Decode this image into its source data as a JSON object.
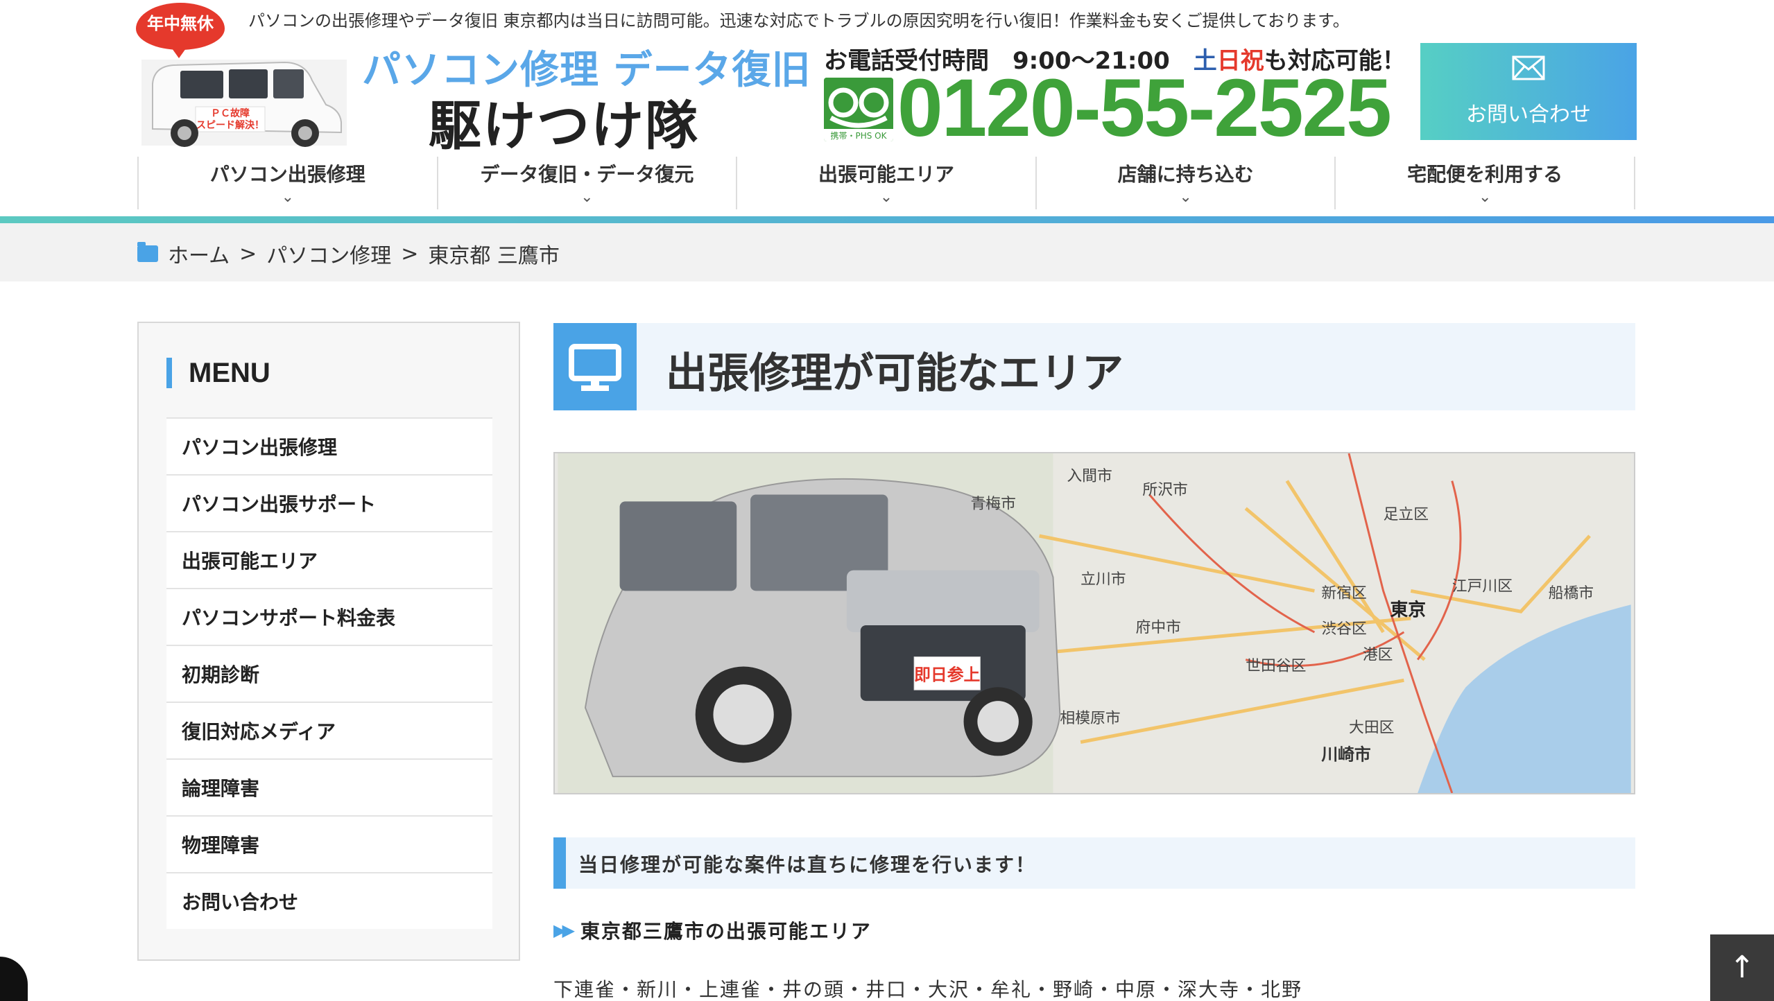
{
  "header": {
    "tagline": "パソコンの出張修理やデータ復旧 東京都内は当日に訪問可能。迅速な対応でトラブルの原因究明を行い復旧！作業料金も安くご提供しております。",
    "badge": "年中無休",
    "van_sticker": "ＰＣ故障 スピード解決！",
    "title_line1": "パソコン修理 データ復旧",
    "title_line2": "駆けつけ隊",
    "hours_prefix": "お電話受付時間　9:00〜21:00　",
    "hours_sat": "土",
    "hours_hol": "日祝",
    "hours_suffix": "も対応可能！",
    "freedial_note": "携帯・PHS OK",
    "phone": "0120-55-2525",
    "contact_label": "お問い合わせ"
  },
  "nav": {
    "items": [
      {
        "label": "パソコン出張修理"
      },
      {
        "label": "データ復旧・データ復元"
      },
      {
        "label": "出張可能エリア"
      },
      {
        "label": "店舗に持ち込む"
      },
      {
        "label": "宅配便を利用する"
      }
    ],
    "chevron": "⌄"
  },
  "breadcrumb": {
    "home": "ホーム",
    "sep": ">",
    "level1": "パソコン修理",
    "current": "東京都 三鷹市"
  },
  "sidebar": {
    "title": "MENU",
    "items": [
      {
        "label": "パソコン出張修理"
      },
      {
        "label": "パソコン出張サポート"
      },
      {
        "label": "出張可能エリア"
      },
      {
        "label": "パソコンサポート料金表"
      },
      {
        "label": "初期診断"
      },
      {
        "label": "復旧対応メディア"
      },
      {
        "label": "論理障害"
      },
      {
        "label": "物理障害"
      },
      {
        "label": "お問い合わせ"
      }
    ]
  },
  "main": {
    "heading": "出張修理が可能なエリア",
    "hero": {
      "plate": "即日参上",
      "labels": [
        "入間市",
        "所沢市",
        "青梅市",
        "足立区",
        "立川市",
        "新宿区",
        "東京",
        "江戸川区",
        "船橋市",
        "府中市",
        "渋谷区",
        "港区",
        "世田谷区",
        "大田区",
        "川崎市",
        "相模原市"
      ]
    },
    "subheading": "当日修理が可能な案件は直ちに修理を行います！",
    "area_title": "東京都三鷹市の出張可能エリア",
    "area_list": "下連雀・新川・上連雀・井の頭・井口・大沢・牟礼・野崎・中原・深大寺・北野"
  },
  "totop": "↑"
}
